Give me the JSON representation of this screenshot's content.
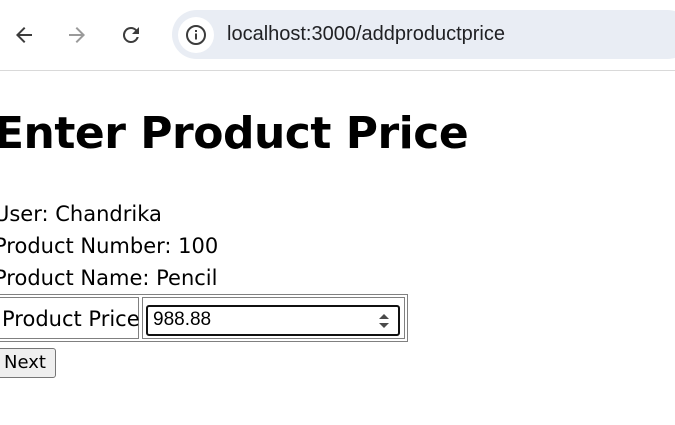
{
  "browser": {
    "url": "localhost:3000/addproductprice",
    "icons": {
      "back": "back-arrow-icon",
      "forward": "forward-arrow-icon",
      "reload": "reload-icon",
      "site_info": "info-icon"
    }
  },
  "page": {
    "title": "Enter Product Price",
    "user_line": "User: Chandrika",
    "product_number_line": "Product Number: 100",
    "product_name_line": "Product Name: Pencil",
    "price_label": "Product Price",
    "price_value": "988.88",
    "next_label": "Next"
  }
}
